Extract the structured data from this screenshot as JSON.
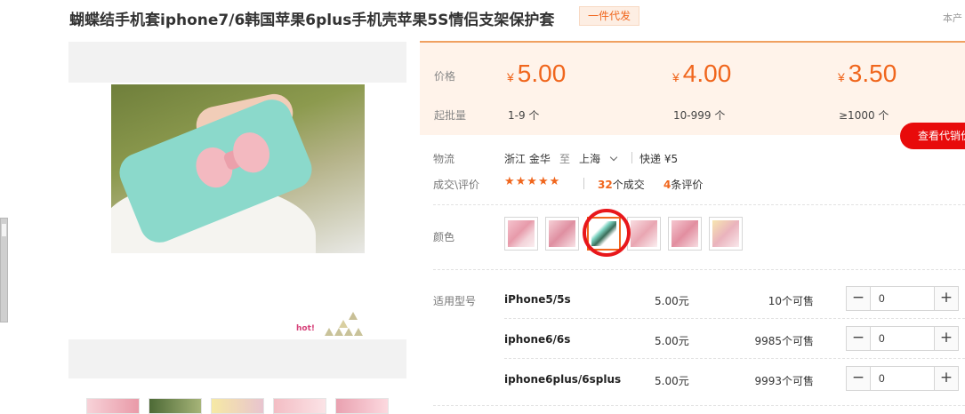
{
  "title": "蝴蝶结手机套iphone7/6韩国苹果6plus手机壳苹果5S情侣支架保护套",
  "badge": "一件代发",
  "corner_text": "本产",
  "gallery": {
    "hot_text": "hot!"
  },
  "price_table": {
    "price_label": "价格",
    "moq_label": "起批量",
    "currency": "¥",
    "tiers": [
      {
        "price": "5.00",
        "range": "1-9 个"
      },
      {
        "price": "4.00",
        "range": "10-999 个"
      },
      {
        "price": "3.50",
        "range": "≥1000 个"
      }
    ]
  },
  "agent_button": "查看代销价",
  "logistics": {
    "label": "物流",
    "from": "浙江 金华",
    "to_word": "至",
    "to": "上海",
    "shipping": "快递 ¥5"
  },
  "deals": {
    "label": "成交\\评价",
    "stars": "★★★★★",
    "rating": 5,
    "deal_count": "32",
    "deal_suffix": "个成交",
    "review_count": "4",
    "review_suffix": "条评价"
  },
  "color": {
    "label": "颜色",
    "swatch_count": 6,
    "selected_index": 2
  },
  "models": {
    "label": "适用型号",
    "rows": [
      {
        "name": "iPhone5/5s",
        "price": "5.00元",
        "stock": "10个可售",
        "qty": "0"
      },
      {
        "name": "iphone6/6s",
        "price": "5.00元",
        "stock": "9985个可售",
        "qty": "0"
      },
      {
        "name": "iphone6plus/6splus",
        "price": "5.00元",
        "stock": "9993个可售",
        "qty": "0"
      }
    ],
    "minus_glyph": "−",
    "plus_glyph": "+"
  },
  "colors": {
    "accent": "#f0661d",
    "panel_bg": "#fff3ea",
    "agent_red": "#e80b0b"
  }
}
